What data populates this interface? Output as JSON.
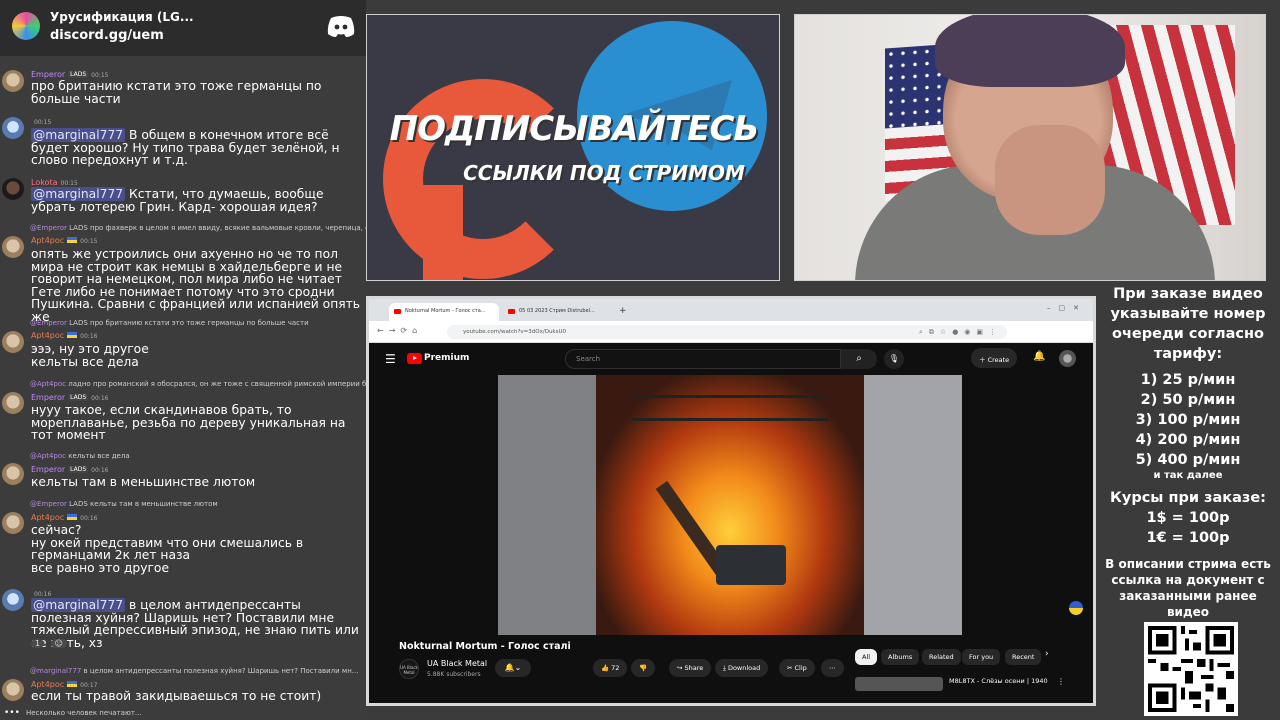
{
  "discord": {
    "server_name": "Урусификация (LG...",
    "invite": "discord.gg/uem"
  },
  "chat": [
    {
      "reply_name": "",
      "reply_text": "",
      "author": "Emperor",
      "badge": "LADS",
      "time": "00:15",
      "text": "про британию кстати это тоже германцы по больше части"
    },
    {
      "author": "",
      "badge": "",
      "time": "00:15",
      "mention": "@marginal777",
      "text": " В общем в конечном итоге всё будет хорошо? Ну типо трава будет зелёной, н слово передохнут и т.д."
    },
    {
      "author": "Lokota",
      "time": "00:15",
      "mention": "@marginal777",
      "text": " Кстати, что думаешь, вообще убрать лотерею Грин. Кард- хорошая идея?"
    },
    {
      "reply_name": "@Emperor",
      "reply_text": "LADS про фахверк в целом я имел ввиду, всякие вальмовые кровли, черепица, сла",
      "author": "Apt4poc",
      "time": "00:15",
      "text": "опять же устроились они ахуенно но че то пол мира не строит как немцы в хайдельберге и не говорит на немецком, пол мира либо не читает Гете либо не понимает потому что это сродни Пушкина. Сравни с францией или испанией опять же"
    },
    {
      "reply_name": "@Emperor",
      "reply_text": "LADS про британию кстати это тоже германцы по больше части",
      "author": "Apt4poc",
      "time": "00:16",
      "text": "эээ, ну это другое\nкельты все дела"
    },
    {
      "reply_name": "@Apt4poc",
      "reply_text": "ладно про романский я обосрался, он же тоже с священной римской империи был р",
      "author": "Emperor",
      "badge": "LADS",
      "time": "00:16",
      "text": "нууу такое, если скандинавов брать, то мореплаванье, резьба по дереву уникальная на тот момент"
    },
    {
      "reply_name": "@Apt4poc",
      "reply_text": "кельты все дела",
      "author": "Emperor",
      "badge": "LADS",
      "time": "00:16",
      "text": "кельты там в меньшинстве лютом"
    },
    {
      "reply_name": "@Emperor",
      "reply_text": "LADS кельты там в меньшинстве лютом",
      "author": "Apt4poc",
      "time": "00:16",
      "text": "сейчас?\nну окей представим что они смешались в германцами 2к лет наза\nвсе равно это другое"
    },
    {
      "author": "",
      "time": "00:16",
      "mention": "@marginal777",
      "text": " в целом антидепрессанты полезная хуйня? Шаришь нет? Поставили мне тяжелый депрессивный эпизод, не знаю пить или не пить, хз",
      "reactions": [
        "1",
        "☺"
      ]
    },
    {
      "reply_name": "@marginal777",
      "reply_text": "в целом антидепрессанты полезная хуйня? Шаришь нет? Поставили мн...",
      "author": "Apt4poc",
      "time": "00:17",
      "text": "если ты травой закидываешься то не стоит)"
    }
  ],
  "typing": "Несколько человек печатают...",
  "promo": {
    "title": "ПОДПИСЫВАЙТЕСЬ",
    "subtitle": "ССЫЛКИ ПОД СТРИМОМ"
  },
  "browser": {
    "tab1": "Nokturnal Mortum - Голос ста...",
    "tab2": "05 03 2023 Стрим Distrubel...",
    "url": "youtube.com/watch?v=3dOx/DuksU0"
  },
  "youtube": {
    "brand": "Premium",
    "search_placeholder": "Search",
    "create_label": "Create",
    "video_title": "Nokturnal Mortum - Голос сталі",
    "channel_name": "UA Black Metal",
    "channel_avatar_text": "UA Black Metal",
    "subscribers": "5.88K subscribers",
    "likes": "72",
    "share_label": "Share",
    "download_label": "Download",
    "clip_label": "Clip",
    "chips": [
      "All",
      "Albums",
      "Related",
      "For you",
      "Recent"
    ],
    "rec_title": "M8L8TX - Слёзы осени | 1940"
  },
  "info": {
    "intro": "При заказе видео указывайте номер очереди согласно тарифу:",
    "tariffs": [
      "1) 25 р/мин",
      "2) 50 р/мин",
      "3) 100 р/мин",
      "4) 200 р/мин",
      "5) 400 р/мин"
    ],
    "etc": "и так далее",
    "rates_title": "Курсы при заказе:",
    "rate_usd": "1$ = 100р",
    "rate_eur": "1€ = 100р",
    "footer": "В описании стрима есть ссылка на документ с заказанными ранее видео"
  }
}
